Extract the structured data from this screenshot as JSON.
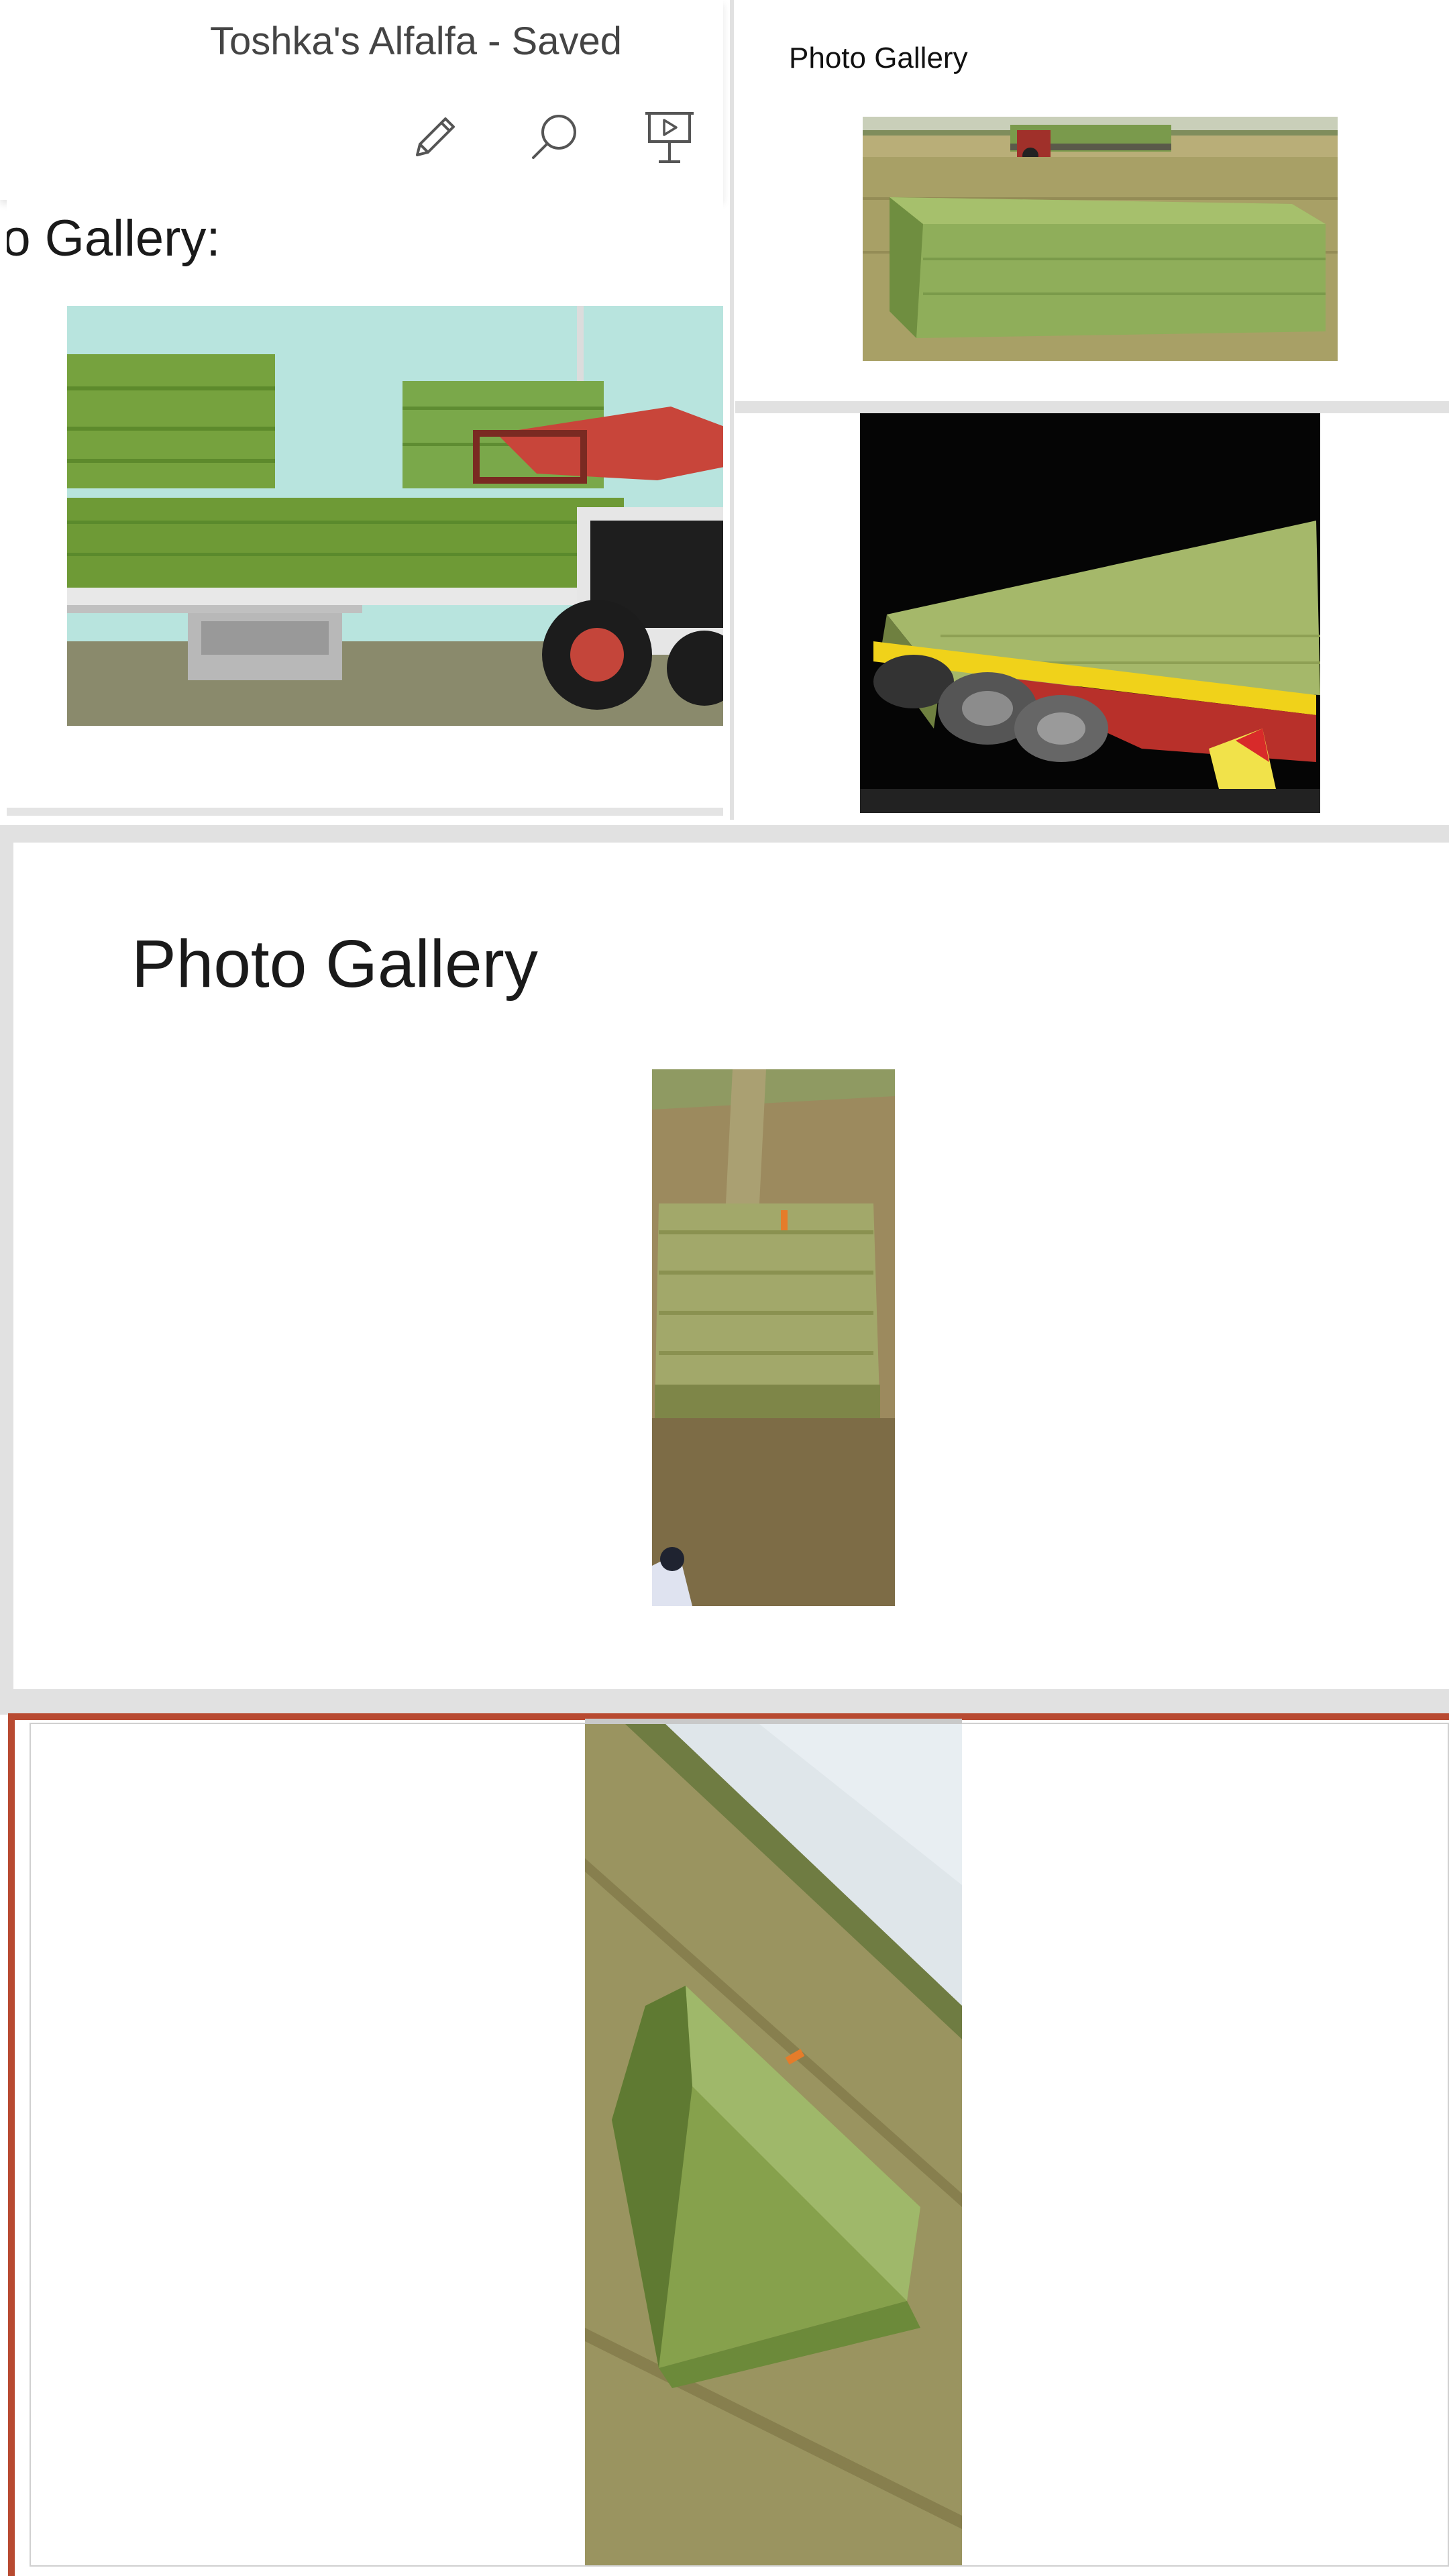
{
  "header": {
    "title": "Toshka's Alfalfa - Saved",
    "tools": [
      {
        "name": "edit",
        "icon": "pencil-icon"
      },
      {
        "name": "search",
        "icon": "search-icon"
      },
      {
        "name": "present",
        "icon": "presentation-play-icon"
      }
    ]
  },
  "slides": [
    {
      "title": "oto Gallery:",
      "photo": "hay-bales-loader-truck"
    },
    {
      "title": "Photo Gallery",
      "photo": "hay-bale-field-tractor"
    },
    {
      "title": "",
      "photo": "hay-bales-truck-night"
    },
    {
      "title": "Photo Gallery",
      "photo": "hay-bale-field-topdown"
    },
    {
      "title": "",
      "photo": "hay-bale-field-angled"
    }
  ],
  "colors": {
    "accent": "#b84a31",
    "divider": "#e1e1e1",
    "text": "#444444"
  }
}
